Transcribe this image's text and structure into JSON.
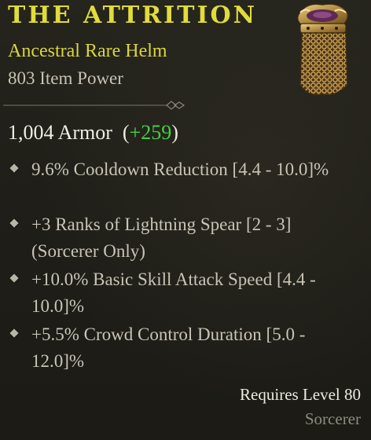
{
  "item": {
    "name": "THE ATTRITION",
    "subtype": "Ancestral Rare Helm",
    "item_power": "803 Item Power",
    "icon": "rare-helm-icon"
  },
  "armor": {
    "value": "1,004 Armor",
    "bonus_open": "(",
    "bonus": "+259",
    "bonus_close": ")"
  },
  "affixes": [
    {
      "text": "9.6% Cooldown Reduction [4.4 - 10.0]%"
    },
    {
      "text": "+3 Ranks of Lightning Spear [2 - 3] (Sorcerer Only)"
    },
    {
      "text": "+10.0% Basic Skill Attack Speed  [4.4 - 10.0]%"
    },
    {
      "text": "+5.5% Crowd Control Duration [5.0 - 12.0]%"
    }
  ],
  "requirements": {
    "level": "Requires Level 80",
    "class": "Sorcerer"
  },
  "colors": {
    "title": "#e0dc3a",
    "subtype": "#d9d63e",
    "bonus": "#44d044",
    "background": "#1f1e18"
  }
}
